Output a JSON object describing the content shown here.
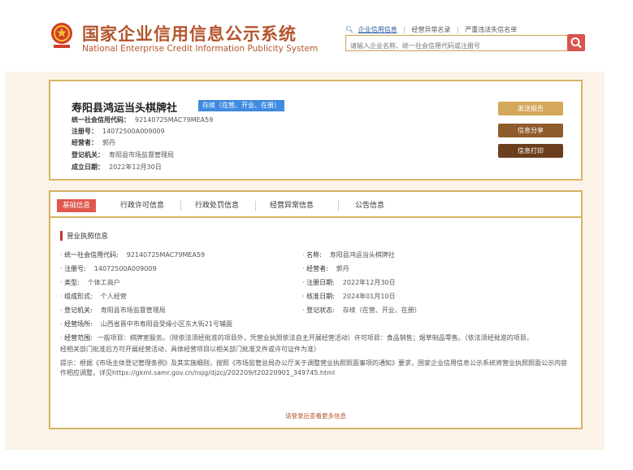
{
  "header": {
    "title_cn": "国家企业信用信息公示系统",
    "title_en": "National Enterprise Credit Information Publicity System",
    "links": [
      "企业信用信息",
      "经营异常名录",
      "严重违法失信名单"
    ],
    "search_placeholder": "请输入企业名称、统一社会信用代码或注册号"
  },
  "summary": {
    "company_name": "寿阳县鸿运当头棋牌社",
    "status_badge": "存续（在营、开业、在册）",
    "credit_code_label": "统一社会信用代码：",
    "credit_code": "92140725MAC79MEA59",
    "reg_no_label": "注册号：",
    "reg_no": "14072500A009009",
    "operator_label": "经营者：",
    "operator": "郭丹",
    "authority_label": "登记机关：",
    "authority": "寿阳县市场监督管理局",
    "date_label": "成立日期：",
    "date": "2022年12月30日",
    "buttons": [
      "发送报告",
      "信息分享",
      "信息打印"
    ]
  },
  "tabs": [
    "基础信息",
    "行政许可信息",
    "行政处罚信息",
    "经营异常信息",
    "公告信息"
  ],
  "license": {
    "section_title": "营业执照信息",
    "fields_left": [
      {
        "label": "统一社会信用代码:",
        "value": "92140725MAC79MEA59"
      },
      {
        "label": "注册号:",
        "value": "14072500A009009"
      },
      {
        "label": "类型:",
        "value": "个体工商户"
      },
      {
        "label": "组成形式:",
        "value": "个人经营"
      },
      {
        "label": "登记机关:",
        "value": "寿阳县市场监督管理局"
      },
      {
        "label": "经营场所:",
        "value": "山西省晋中市寿阳县受缘小区东大街21号辅面"
      }
    ],
    "fields_right": [
      {
        "label": "名称:",
        "value": "寿阳县鸿运当头棋牌社"
      },
      {
        "label": "经营者:",
        "value": "郭丹"
      },
      {
        "label": "注册日期:",
        "value": "2022年12月30日"
      },
      {
        "label": "核准日期:",
        "value": "2024年01月10日"
      },
      {
        "label": "登记状态:",
        "value": "存续（在营、开业、在册）"
      }
    ],
    "scope_label": "经营范围:",
    "scope_line1": "一般项目：棋牌室服务。（除依法须经批准的项目外，凭营业执照依法自主开展经营活动）许可项目：食品销售；烟草制品零售。（依法须经批准的项目，",
    "scope_line2": "经相关部门批准后方可开展经营活动，具体经营项目以相关部门批准文件或许可证件为准）",
    "notice": "提示：根据《市场主体登记管理条例》及其实施细则，按照《市场监管总局办公厅关于调整营业执照照面事项的通知》要求，国家企业信用信息公示系统将营业执照照面公示内容作相应调整，详见https://gkml.samr.gov.cn/nsjg/djzcj/202209/t20220901_349745.html",
    "more": "请登录后查看更多信息"
  },
  "colors": {
    "brand": "#b3552b",
    "gold": "#d6b461",
    "red": "#e0574f",
    "blue": "#3f8be0"
  }
}
